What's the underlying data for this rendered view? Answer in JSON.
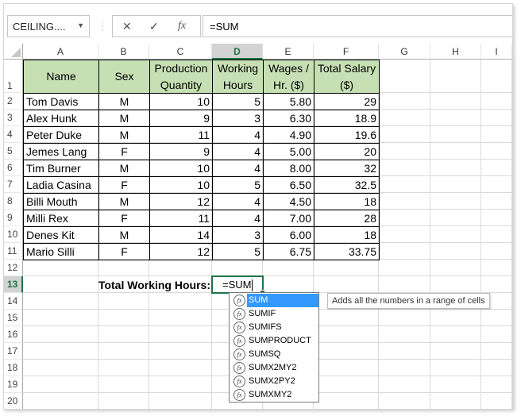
{
  "formula_bar": {
    "name_box": "CEILING....",
    "cancel_icon": "✕",
    "enter_icon": "✓",
    "fx_label": "fx",
    "formula": "=SUM"
  },
  "columns": [
    "A",
    "B",
    "C",
    "D",
    "E",
    "F",
    "G",
    "H",
    "I"
  ],
  "selected_column": "D",
  "rows": [
    "1",
    "2",
    "3",
    "4",
    "5",
    "6",
    "7",
    "8",
    "9",
    "10",
    "11",
    "12",
    "13",
    "14",
    "15",
    "16",
    "17",
    "18",
    "19",
    "20"
  ],
  "selected_row": "13",
  "table": {
    "headers": [
      [
        "Name"
      ],
      [
        "Sex"
      ],
      [
        "Production",
        "Quantity"
      ],
      [
        "Working",
        "Hours"
      ],
      [
        "Wages /",
        "Hr. ($)"
      ],
      [
        "Total Salary",
        "($)"
      ]
    ],
    "data": [
      [
        "Tom Davis",
        "M",
        "10",
        "5",
        "5.80",
        "29"
      ],
      [
        "Alex Hunk",
        "M",
        "9",
        "3",
        "6.30",
        "18.9"
      ],
      [
        "Peter Duke",
        "M",
        "11",
        "4",
        "4.90",
        "19.6"
      ],
      [
        "Jemes Lang",
        "F",
        "9",
        "4",
        "5.00",
        "20"
      ],
      [
        "Tim Burner",
        "M",
        "10",
        "4",
        "8.00",
        "32"
      ],
      [
        "Ladia Casina",
        "F",
        "10",
        "5",
        "6.50",
        "32.5"
      ],
      [
        "Billi Mouth",
        "M",
        "12",
        "4",
        "4.50",
        "18"
      ],
      [
        "Milli Rex",
        "F",
        "11",
        "4",
        "7.00",
        "28"
      ],
      [
        "Denes Kit",
        "M",
        "14",
        "3",
        "6.00",
        "18"
      ],
      [
        "Mario Silli",
        "F",
        "12",
        "5",
        "6.75",
        "33.75"
      ]
    ]
  },
  "total_label": "Total Working Hours:",
  "active_cell_value": "=SUM",
  "autocomplete": {
    "items": [
      "SUM",
      "SUMIF",
      "SUMIFS",
      "SUMPRODUCT",
      "SUMSQ",
      "SUMX2MY2",
      "SUMX2PY2",
      "SUMXMY2"
    ],
    "selected": "SUM",
    "tooltip": "Adds all the numbers in a range of cells",
    "fx_glyph": "fx"
  }
}
